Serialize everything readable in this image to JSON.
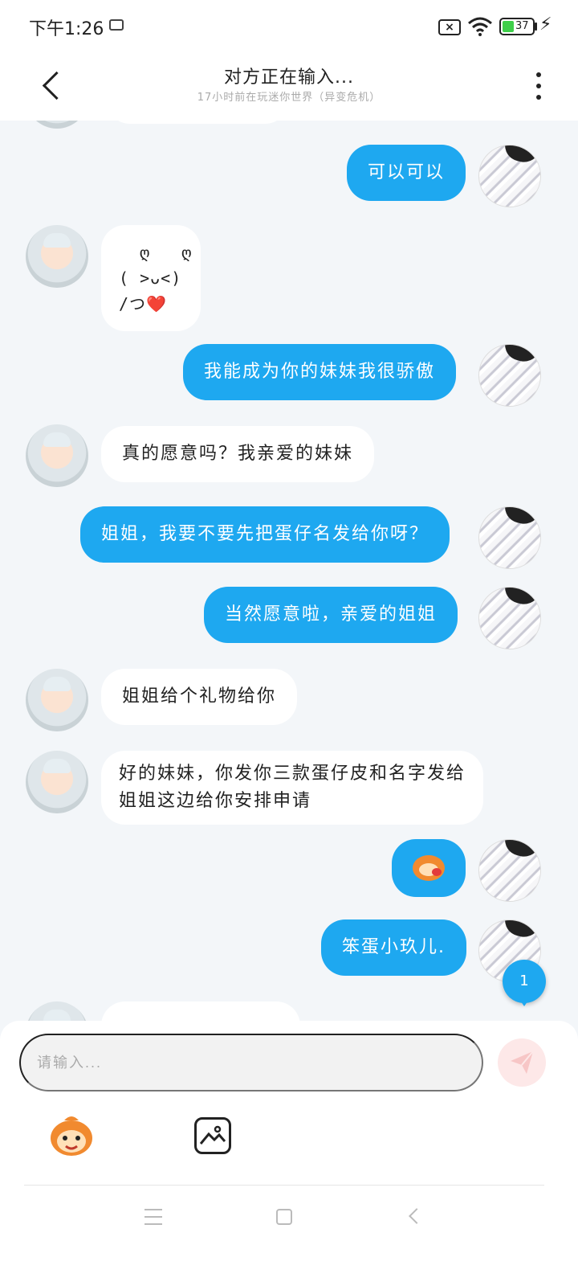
{
  "status_bar": {
    "time": "下午1:26",
    "battery_level": "37"
  },
  "header": {
    "title": "对方正在输入...",
    "subtitle": "17小时前在玩迷你世界（异变危机）"
  },
  "messages": [
    {
      "from": "me",
      "text": "可以可以"
    },
    {
      "from": "them",
      "text": "  ღ   ღ\n( >ᴗ<)\n/つ"
    },
    {
      "from": "me",
      "text": "我能成为你的妹妹我很骄傲"
    },
    {
      "from": "them",
      "text": "真的愿意吗？我亲爱的妹妹"
    },
    {
      "from": "me",
      "text": "姐姐，我要不要先把蛋仔名发给你呀？"
    },
    {
      "from": "me",
      "text": "当然愿意啦，亲爱的姐姐"
    },
    {
      "from": "them",
      "text": "姐姐给个礼物给你"
    },
    {
      "from": "them",
      "text": "好的妹妹，你发你三款蛋仔皮和名字发给姐姐这边给你安排申请"
    },
    {
      "from": "me",
      "text": "sticker"
    },
    {
      "from": "me",
      "text": "笨蛋小玖儿."
    }
  ],
  "kaomoji_heart": "❤️",
  "unread_badge": "1",
  "composer": {
    "placeholder": "请输入..."
  },
  "icons": {
    "back": "back-arrow-icon",
    "more": "more-vertical-icon",
    "send": "send-paper-plane-icon",
    "emoji": "emoji-mascot-icon",
    "image": "image-icon"
  },
  "colors": {
    "my_bubble": "#1ea8f0",
    "their_bubble": "#ffffff",
    "background": "#f3f6f9"
  }
}
